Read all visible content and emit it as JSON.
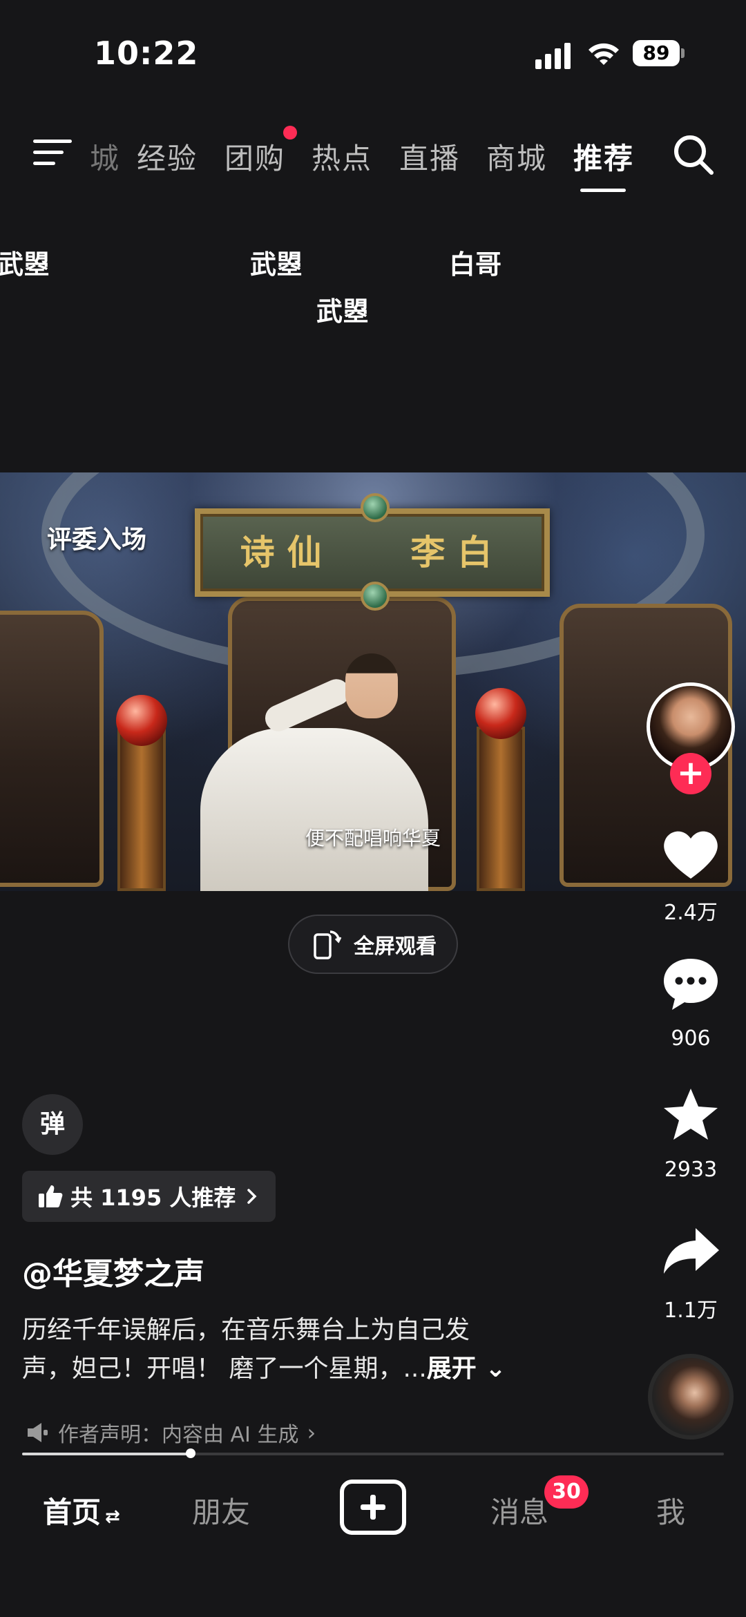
{
  "status": {
    "time": "10:22",
    "battery": "89"
  },
  "top_tabs": {
    "partial": "城",
    "items": [
      "经验",
      "团购",
      "热点",
      "直播",
      "商城",
      "推荐"
    ],
    "active": "推荐"
  },
  "danmaku": [
    "武曌",
    "武曌",
    "白哥",
    "武曌"
  ],
  "video": {
    "tag": "评委入场",
    "plaque_left": "诗仙",
    "plaque_right": "李白",
    "subtitle": "便不配唱响华夏",
    "fullscreen_label": "全屏观看"
  },
  "rail": {
    "likes": "2.4万",
    "comments": "906",
    "favorites": "2933",
    "shares": "1.1万"
  },
  "info": {
    "danmaku_toggle": "弹",
    "recommend": "共 1195 人推荐",
    "author": "@华夏梦之声",
    "desc_line1": "历经千年误解后，在音乐舞台上为自己发",
    "desc_line2": "声，妲己！开唱！ 磨了一个星期，...",
    "expand": "展开",
    "disclaimer": "作者声明：内容由 AI 生成",
    "progress": 0.24
  },
  "nav": {
    "home": "首页",
    "friends": "朋友",
    "messages": "消息",
    "messages_badge": "30",
    "me": "我"
  },
  "colors": {
    "accent": "#fe2c55",
    "background": "#161618"
  },
  "icons": [
    "menu-icon",
    "search-icon",
    "heart-icon",
    "comment-icon",
    "star-icon",
    "share-icon",
    "thumb-up-icon",
    "speaker-icon",
    "plus-icon",
    "rotate-screen-icon"
  ]
}
